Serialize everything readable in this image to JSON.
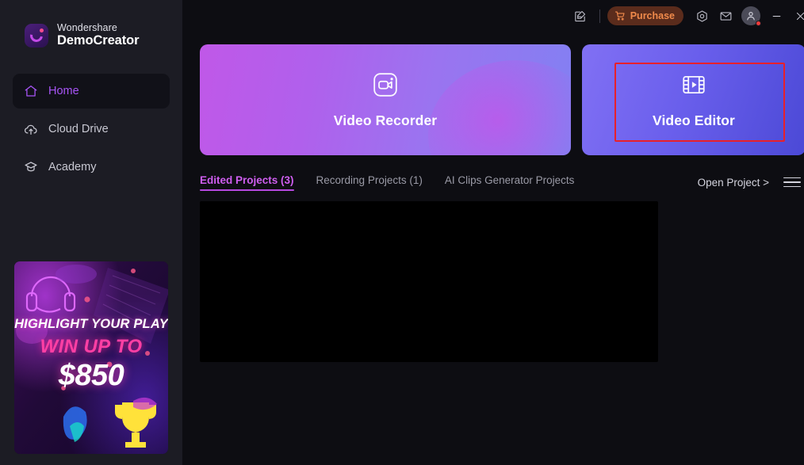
{
  "brand": {
    "company": "Wondershare",
    "product": "DemoCreator",
    "logo_icon": "democreator-logo-icon"
  },
  "sidebar": {
    "items": [
      {
        "label": "Home",
        "icon": "home-icon",
        "active": true
      },
      {
        "label": "Cloud Drive",
        "icon": "cloud-upload-icon",
        "active": false
      },
      {
        "label": "Academy",
        "icon": "graduation-cap-icon",
        "active": false
      }
    ],
    "promo": {
      "line1": "HIGHLIGHT YOUR PLAY",
      "line2": "WIN UP TO",
      "line3": "$850"
    }
  },
  "titlebar": {
    "feedback_icon": "feedback-note-icon",
    "purchase_label": "Purchase",
    "purchase_icon": "shopping-cart-icon",
    "settings_icon": "settings-gear-icon",
    "mail_icon": "mail-envelope-icon",
    "account_icon": "user-avatar-icon",
    "minimize_icon": "minimize-icon",
    "close_icon": "close-icon",
    "accent_purchase_bg": "#5b2c1c",
    "accent_purchase_fg": "#f08a4b",
    "notification_dot": "#f03b3b"
  },
  "cards": [
    {
      "label": "Video Recorder",
      "icon": "video-camera-icon",
      "gradient_from": "#c058e8",
      "gradient_to": "#8280f2",
      "highlighted": false
    },
    {
      "label": "Video Editor",
      "icon": "film-strip-play-icon",
      "gradient_from": "#8170f4",
      "gradient_to": "#4b49d6",
      "highlighted": true,
      "highlight_color": "#e8202a"
    }
  ],
  "tabs": [
    {
      "label": "Edited Projects (3)",
      "active": true
    },
    {
      "label": "Recording Projects (1)",
      "active": false
    },
    {
      "label": "AI Clips Generator Projects",
      "active": false
    }
  ],
  "tab_accent": "#cf5ef0",
  "actions": {
    "open_project": "Open Project >",
    "menu_icon": "hamburger-menu-icon"
  },
  "projects": [
    {
      "thumbnail": "black-video-thumbnail"
    }
  ]
}
